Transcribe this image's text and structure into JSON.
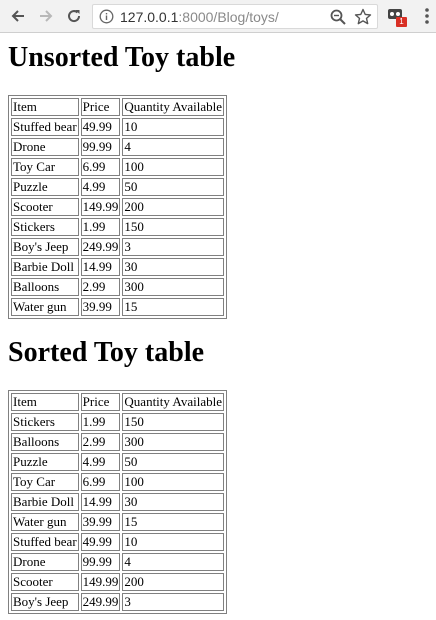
{
  "browser": {
    "url_host": "127.0.0.1",
    "url_path": ":8000/Blog/toys/",
    "extension_badge": "1"
  },
  "unsorted": {
    "title": "Unsorted Toy table",
    "headers": [
      "Item",
      "Price",
      "Quantity Available"
    ],
    "rows": [
      [
        "Stuffed bear",
        "49.99",
        "10"
      ],
      [
        "Drone",
        "99.99",
        "4"
      ],
      [
        "Toy Car",
        "6.99",
        "100"
      ],
      [
        "Puzzle",
        "4.99",
        "50"
      ],
      [
        "Scooter",
        "149.99",
        "200"
      ],
      [
        "Stickers",
        "1.99",
        "150"
      ],
      [
        "Boy's Jeep",
        "249.99",
        "3"
      ],
      [
        "Barbie Doll",
        "14.99",
        "30"
      ],
      [
        "Balloons",
        "2.99",
        "300"
      ],
      [
        "Water gun",
        "39.99",
        "15"
      ]
    ]
  },
  "sorted": {
    "title": "Sorted Toy table",
    "headers": [
      "Item",
      "Price",
      "Quantity Available"
    ],
    "rows": [
      [
        "Stickers",
        "1.99",
        "150"
      ],
      [
        "Balloons",
        "2.99",
        "300"
      ],
      [
        "Puzzle",
        "4.99",
        "50"
      ],
      [
        "Toy Car",
        "6.99",
        "100"
      ],
      [
        "Barbie Doll",
        "14.99",
        "30"
      ],
      [
        "Water gun",
        "39.99",
        "15"
      ],
      [
        "Stuffed bear",
        "49.99",
        "10"
      ],
      [
        "Drone",
        "99.99",
        "4"
      ],
      [
        "Scooter",
        "149.99",
        "200"
      ],
      [
        "Boy's Jeep",
        "249.99",
        "3"
      ]
    ]
  }
}
